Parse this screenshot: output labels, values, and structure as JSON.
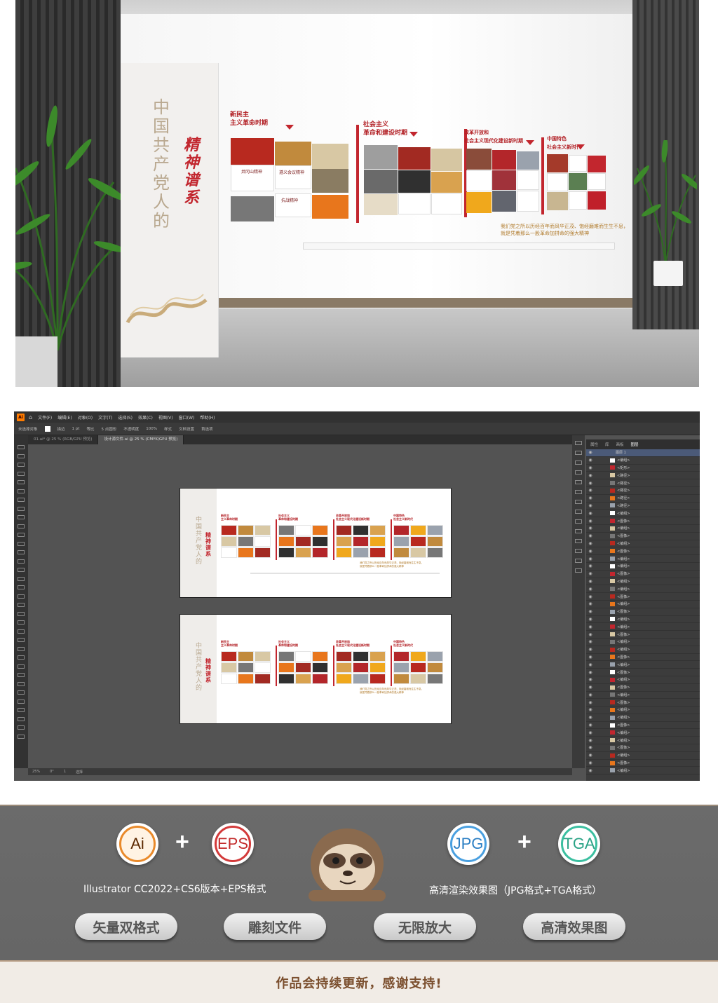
{
  "render": {
    "vertical_title": "中国共产党人的",
    "spirit_title": "精神谱系",
    "sections": [
      {
        "title": "新民主\n主义革命时期"
      },
      {
        "title": "社会主义\n革命和建设时期"
      },
      {
        "title": "改革开放和\n社会主义现代化建设新时期"
      },
      {
        "title": "中国特色\n社会主义新时代"
      }
    ],
    "captions": [
      "井冈山精神",
      "遵义会议精神",
      "抗战精神"
    ],
    "footer": "我们党之所以历经百年而风华正茂、饱经磨难而生生不息，\n就是凭着那么一股革命加拼命的强大精神"
  },
  "illustrator": {
    "menu": [
      "文件(F)",
      "编辑(E)",
      "对象(O)",
      "文字(T)",
      "选择(S)",
      "效果(C)",
      "视图(V)",
      "窗口(W)",
      "帮助(H)"
    ],
    "control_bar": [
      "未选择对象",
      "描边",
      "1 pt",
      "等比",
      "5 点圆形",
      "不透明度",
      "100%",
      "样式",
      "文档设置",
      "首选项"
    ],
    "tabs": [
      "01.ai* @ 25 % (RGB/GPU 预览)",
      "设计源文件.ai @ 25 % (CMYK/GPU 预览)"
    ],
    "layers_tabs": [
      "属性",
      "库",
      "画板",
      "图层"
    ],
    "layer_top": "图层 1",
    "layer_rows": [
      "<编组>",
      "<矩形>",
      "<路径>",
      "<路径>",
      "<路径>",
      "<路径>",
      "<路径>",
      "<编组>",
      "<图像>",
      "<编组>",
      "<图像>",
      "<编组>",
      "<图像>",
      "<编组>",
      "<编组>",
      "<图像>",
      "<编组>",
      "<编组>",
      "<图像>",
      "<编组>",
      "<图像>",
      "<编组>",
      "<编组>",
      "<图像>",
      "<编组>",
      "<编组>",
      "<图像>",
      "<编组>",
      "<图像>",
      "<编组>",
      "<图像>",
      "<编组>",
      "<图像>",
      "<编组>",
      "<编组>",
      "<图像>",
      "<编组>",
      "<编组>",
      "<图像>",
      "<编组>",
      "<图像>",
      "<编组>"
    ],
    "status": [
      "25%",
      "0°",
      "1",
      "选择"
    ],
    "artboard_titles": [
      "中国共产党人的",
      "精神谱系"
    ],
    "artboard_sections": [
      "新民主\n主义革命时期",
      "社会主义\n革命和建设时期",
      "改革开放和\n社会主义现代化建设新时期",
      "中国特色\n社会主义新时代"
    ],
    "artboard_footer": "我们党之所以历经百年而风华正茂、饱经磨难而生生不息，\n就是凭着那么一股革命加拼命的强大精神"
  },
  "promo": {
    "formats_left": [
      "Ai",
      "EPS"
    ],
    "formats_right": [
      "JPG",
      "TGA"
    ],
    "label_left": "Illustrator CC2022+CS6版本+EPS格式",
    "label_right": "高清渲染效果图（JPG格式+TGA格式）",
    "pills": [
      "矢量双格式",
      "雕刻文件",
      "无限放大",
      "高清效果图"
    ],
    "thanks": "作品会持续更新，感谢支持!"
  },
  "colors": {
    "accent_red": "#c2262e",
    "gold": "#b9a88f",
    "ai_dark": "#323232",
    "promo_gray": "#6b6b6b"
  }
}
